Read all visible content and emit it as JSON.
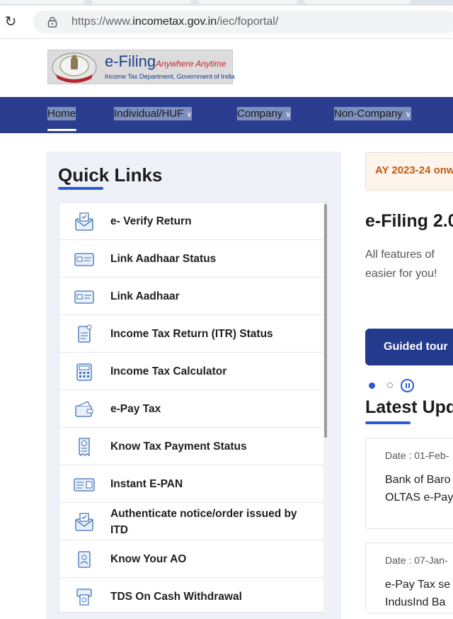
{
  "browser": {
    "url_prefix": "https://www.",
    "url_host": "incometax.gov.in",
    "url_path": "/iec/foportal/"
  },
  "logo": {
    "title": "e-Filing",
    "tagline": "Anywhere Anytime",
    "subtitle": "Income Tax Department, Government of India"
  },
  "nav": {
    "items": [
      {
        "label": "Home"
      },
      {
        "label": "Individual/HUF"
      },
      {
        "label": "Company"
      },
      {
        "label": "Non-Company"
      }
    ]
  },
  "quick_links": {
    "title": "Quick Links",
    "items": [
      {
        "label": "e- Verify Return",
        "icon": "envelope-check-icon"
      },
      {
        "label": "Link Aadhaar Status",
        "icon": "id-card-icon"
      },
      {
        "label": "Link Aadhaar",
        "icon": "id-card-icon"
      },
      {
        "label": "Income Tax Return (ITR) Status",
        "icon": "itr-document-icon"
      },
      {
        "label": "Income Tax Calculator",
        "icon": "calculator-icon"
      },
      {
        "label": "e-Pay Tax",
        "icon": "wallet-icon"
      },
      {
        "label": "Know Tax Payment Status",
        "icon": "receipt-icon"
      },
      {
        "label": "Instant E-PAN",
        "icon": "pan-card-icon"
      },
      {
        "label": "Authenticate notice/order issued by ITD",
        "icon": "envelope-check-icon"
      },
      {
        "label": "Know Your AO",
        "icon": "officer-document-icon"
      },
      {
        "label": "TDS On Cash Withdrawal",
        "icon": "atm-icon"
      }
    ]
  },
  "right": {
    "ay_banner": "AY 2023-24 onw",
    "efiling_title": "e-Filing 2.0",
    "description_line1": "All  features of",
    "description_line2": "easier for you!",
    "guided_tour": "Guided tour",
    "latest_title": "Latest Upd",
    "cards": [
      {
        "date": "Date : 01-Feb-",
        "line1": "Bank of Baro",
        "line2": "OLTAS e-Pay"
      },
      {
        "date": "Date : 07-Jan-",
        "line1": "e-Pay Tax se",
        "line2": "IndusInd Ba"
      }
    ]
  },
  "colors": {
    "nav_bg": "#2a3d8f",
    "accent": "#2a5bd7",
    "ay_text": "#c25b12",
    "button_bg": "#243a8c"
  }
}
